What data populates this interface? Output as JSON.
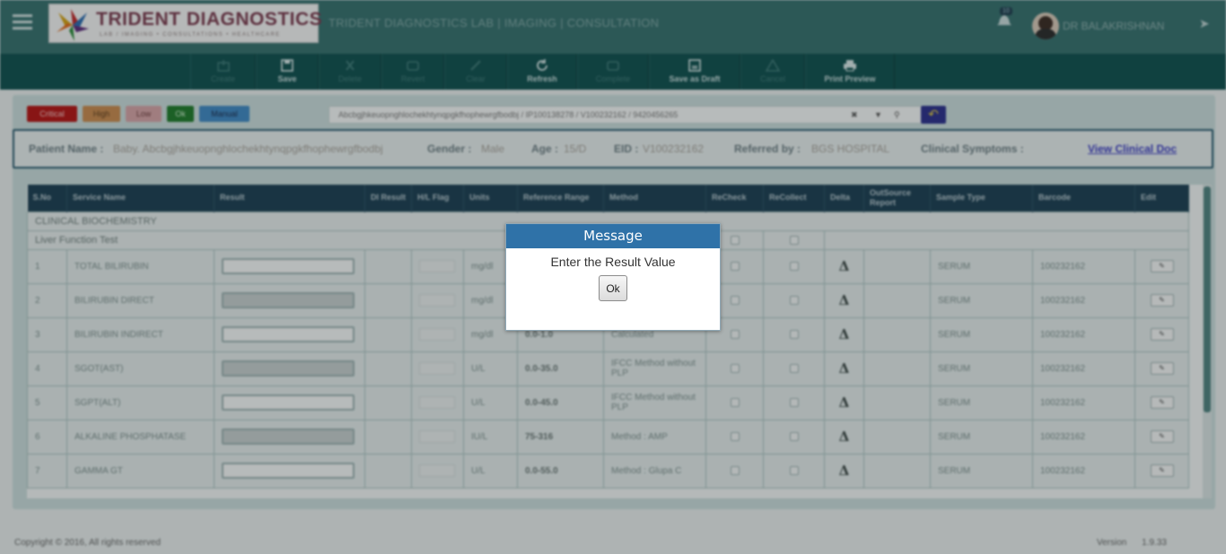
{
  "header": {
    "logo_title": "TRIDENT DIAGNOSTICS",
    "logo_tagline": "LAB / IMAGING • CONSULTATIONS • HEALTHCARE",
    "app_title": "TRIDENT DIAGNOSTICS LAB | IMAGING | CONSULTATION",
    "notification_count": "10",
    "user_name": "DR BALAKRISHNAN"
  },
  "toolbar": [
    {
      "label": "Create",
      "icon": "create-icon",
      "enabled": false
    },
    {
      "label": "Save",
      "icon": "save-icon",
      "enabled": true
    },
    {
      "label": "Delete",
      "icon": "delete-icon",
      "enabled": false
    },
    {
      "label": "Revert",
      "icon": "revert-icon",
      "enabled": false
    },
    {
      "label": "Clear",
      "icon": "clear-icon",
      "enabled": false
    },
    {
      "label": "Refresh",
      "icon": "refresh-icon",
      "enabled": true
    },
    {
      "label": "Complete",
      "icon": "complete-icon",
      "enabled": false
    },
    {
      "label": "Save as Draft",
      "icon": "save-draft-icon",
      "enabled": true
    },
    {
      "label": "Cancel",
      "icon": "cancel-icon",
      "enabled": false
    },
    {
      "label": "Print Preview",
      "icon": "print-icon",
      "enabled": true
    }
  ],
  "legend": [
    {
      "label": "Critical",
      "color": "#b51212",
      "text_color": "#f3c9c9"
    },
    {
      "label": "High",
      "color": "#c98a4e",
      "text_color": "#5a3a1a"
    },
    {
      "label": "Low",
      "color": "#d6a3a6",
      "text_color": "#6a3a3a"
    },
    {
      "label": "Ok",
      "color": "#1f7a2a",
      "text_color": "#d0f0d0"
    },
    {
      "label": "Manual",
      "color": "#3f88c4",
      "text_color": "#1a2a4a"
    }
  ],
  "search": {
    "value": "Abcbgjhkeuopnghlochekhtynqpgkfhophewrgfbodbj  / IP100138278 / V100232162 / 9420456265"
  },
  "patient": {
    "name_label": "Patient Name :",
    "name_value": "Baby. Abcbgjhkeuopnghlochekhtynqpgkfhophewrgfbodbj",
    "gender_label": "Gender :",
    "gender_value": "Male",
    "age_label": "Age :",
    "age_value": "15/D",
    "eid_label": "EID :",
    "eid_value": "V100232162",
    "referred_label": "Referred by :",
    "referred_value": "BGS HOSPITAL",
    "symptoms_label": "Clinical Symptoms :",
    "link_label": "View Clinical Doc"
  },
  "table": {
    "columns": [
      "S.No",
      "Service Name",
      "Result",
      "DI Result",
      "H/L Flag",
      "Units",
      "Reference Range",
      "Method",
      "ReCheck",
      "ReCollect",
      "Delta",
      "OutSource Report",
      "Sample Type",
      "Barcode",
      "Edit"
    ],
    "group": "CLINICAL BIOCHEMISTRY",
    "subgroup": "Liver Function Test",
    "rows": [
      {
        "sno": "1",
        "service": "TOTAL BILIRUBIN",
        "units": "mg/dl",
        "range": "",
        "method": "",
        "sample": "SERUM",
        "barcode": "100232162",
        "disabled": false
      },
      {
        "sno": "2",
        "service": "BILIRUBIN DIRECT",
        "units": "mg/dl",
        "range": "",
        "method": "",
        "sample": "SERUM",
        "barcode": "100232162",
        "disabled": true
      },
      {
        "sno": "3",
        "service": "BILIRUBIN INDIRECT",
        "units": "mg/dl",
        "range": "0.0-1.0",
        "method": "Calculated",
        "sample": "SERUM",
        "barcode": "100232162",
        "disabled": false
      },
      {
        "sno": "4",
        "service": "SGOT(AST)",
        "units": "U/L",
        "range": "0.0-35.0",
        "method": "IFCC Method without PLP",
        "sample": "SERUM",
        "barcode": "100232162",
        "disabled": true
      },
      {
        "sno": "5",
        "service": "SGPT(ALT)",
        "units": "U/L",
        "range": "0.0-45.0",
        "method": "IFCC Method without PLP",
        "sample": "SERUM",
        "barcode": "100232162",
        "disabled": false
      },
      {
        "sno": "6",
        "service": "ALKALINE PHOSPHATASE",
        "units": "IU/L",
        "range": "75-316",
        "method": "Method : AMP",
        "sample": "SERUM",
        "barcode": "100232162",
        "disabled": true
      },
      {
        "sno": "7",
        "service": "GAMMA GT",
        "units": "U/L",
        "range": "0.0-55.0",
        "method": "Method : Glupa C",
        "sample": "SERUM",
        "barcode": "100232162",
        "disabled": false
      }
    ]
  },
  "footer": {
    "copyright": "Copyright © 2016, All rights reserved",
    "version_label": "Version",
    "version_value": "1.9.33"
  },
  "modal": {
    "title": "Message",
    "message": "Enter the Result Value",
    "ok_label": "Ok"
  }
}
